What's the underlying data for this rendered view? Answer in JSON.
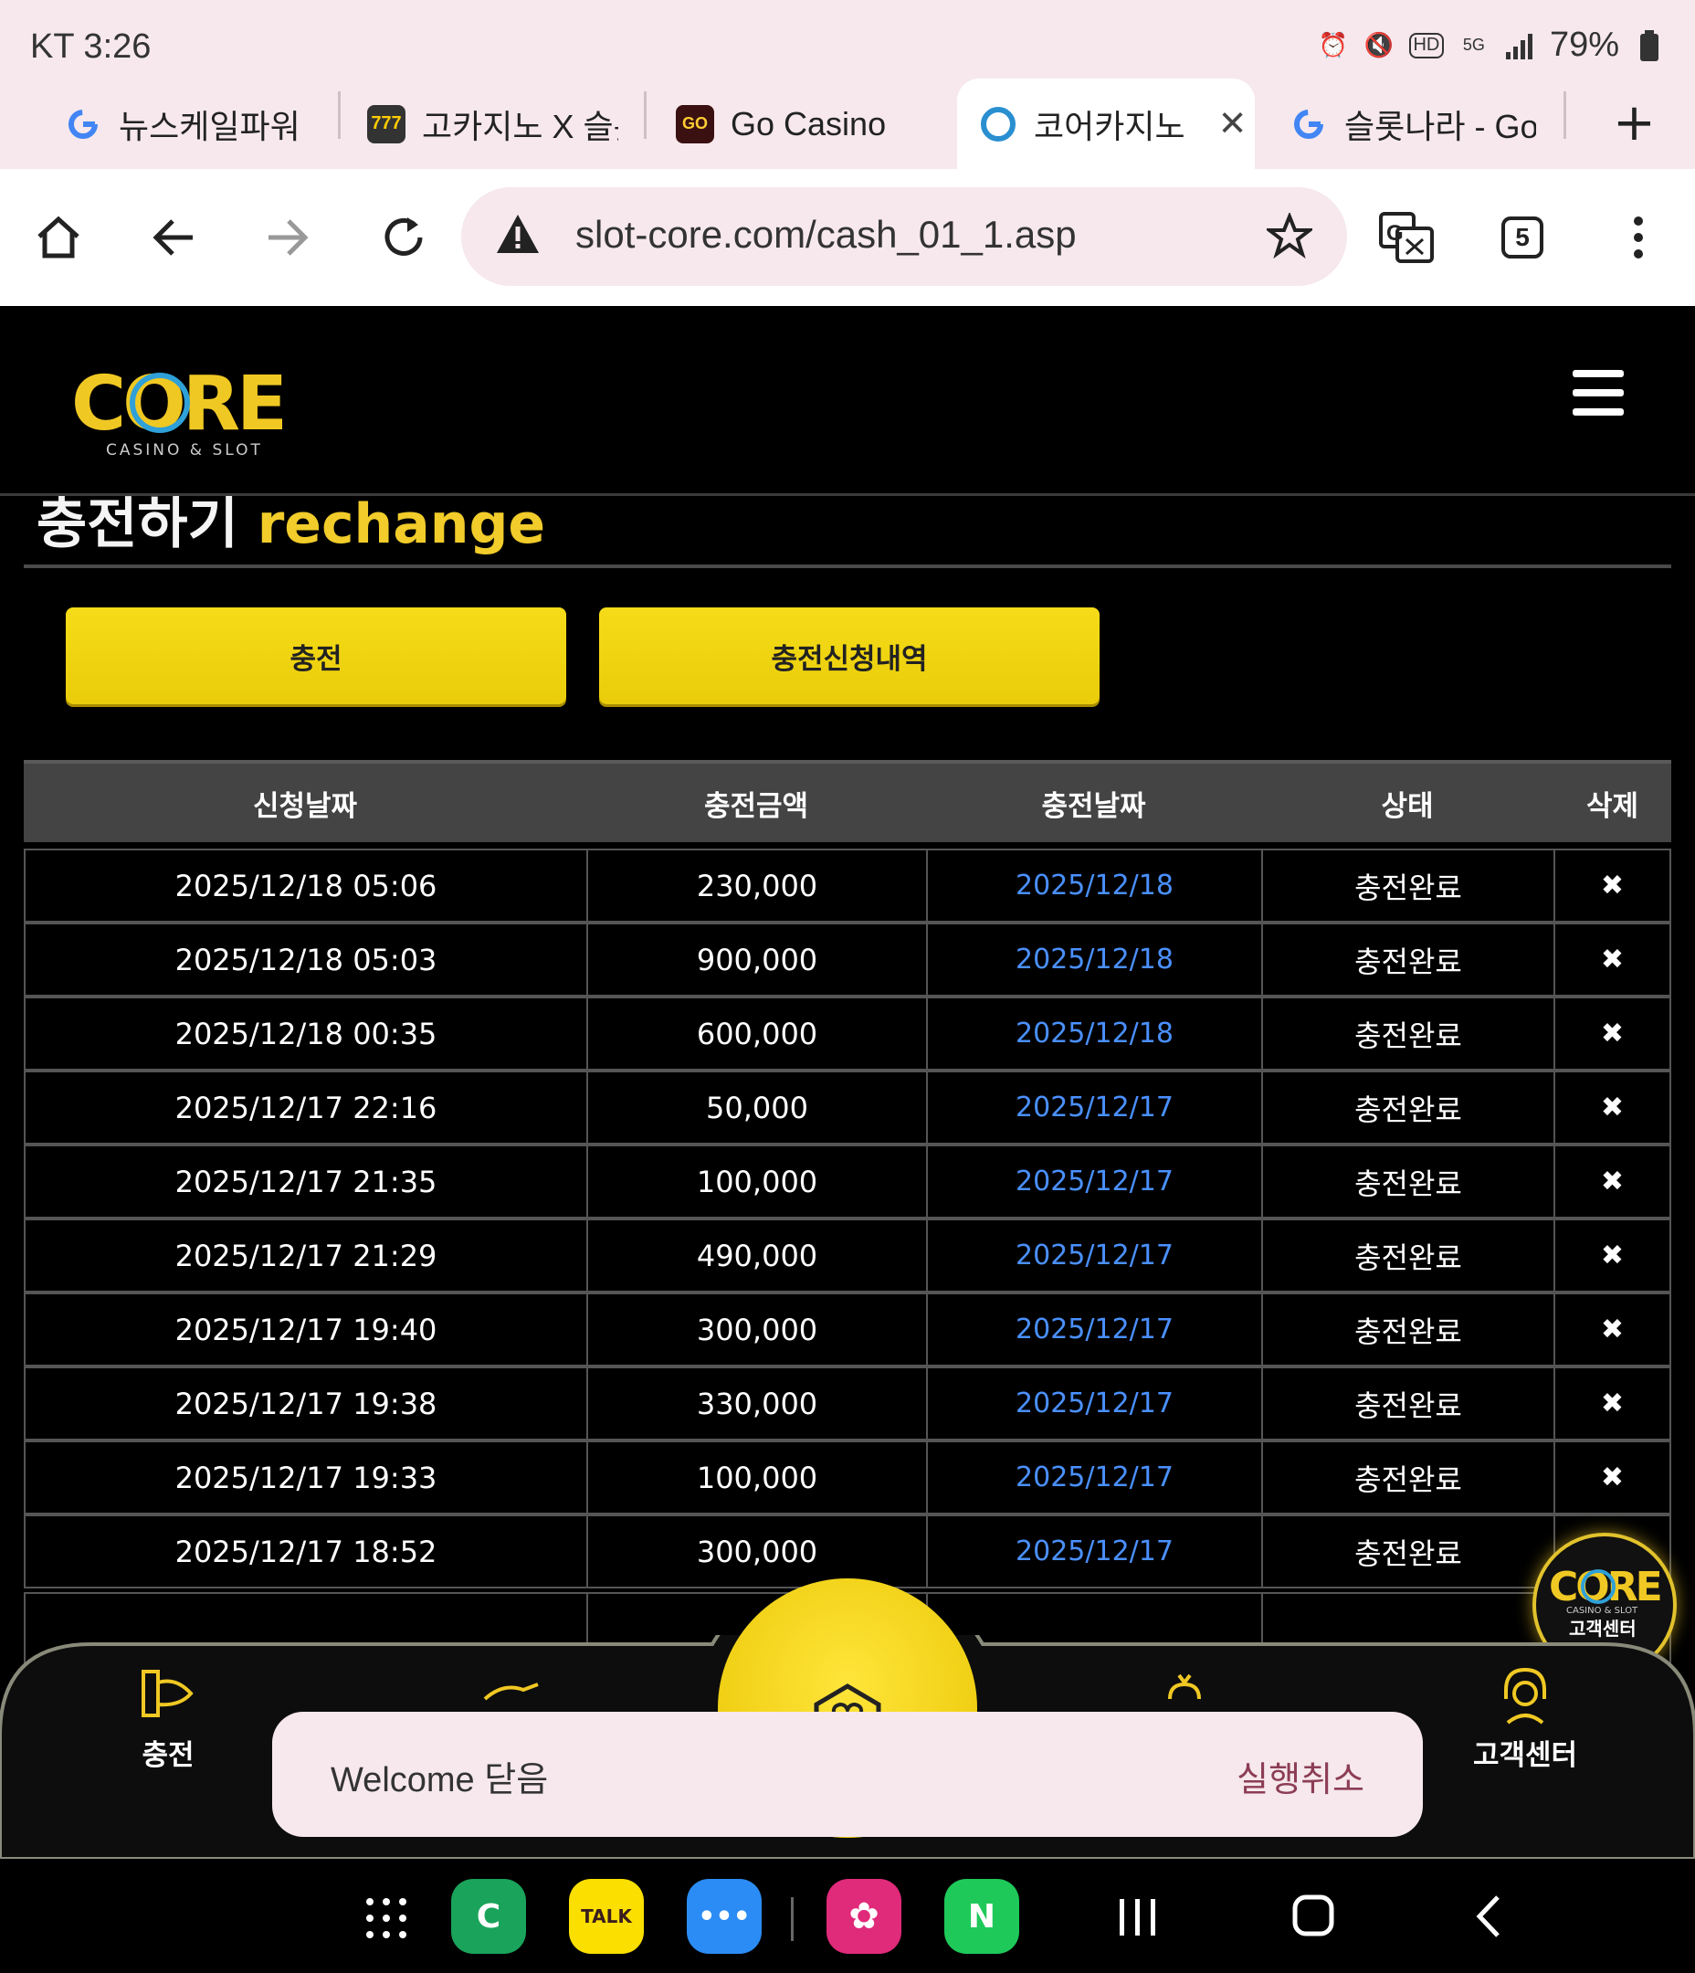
{
  "status_bar": {
    "carrier_time": "KT 3:26",
    "battery": "79%"
  },
  "tabs": [
    {
      "label": "뉴스케일파워 주",
      "favicon": "google-icon"
    },
    {
      "label": "고카지노 X 슬롯",
      "favicon": "slot-icon"
    },
    {
      "label": "Go Casino",
      "favicon": "gocasino-icon"
    },
    {
      "label": "코어카지노",
      "favicon": "core-icon",
      "active": true
    },
    {
      "label": "슬롯나라 - Goo",
      "favicon": "google-icon"
    }
  ],
  "toolbar": {
    "url": "slot-core.com/cash_01_1.asp",
    "tab_count": "5"
  },
  "site": {
    "logo_text": "CORE",
    "logo_sub": "CASINO & SLOT",
    "title_ko": "충전하기",
    "title_en": "rechange",
    "btn_charge": "충전",
    "btn_history": "충전신청내역"
  },
  "table": {
    "headers": [
      "신청날짜",
      "충전금액",
      "충전날짜",
      "상태",
      "삭제"
    ],
    "rows": [
      {
        "req": "2025/12/18 05:06",
        "amount": "230,000",
        "date": "2025/12/18",
        "status": "충전완료",
        "del": "✖"
      },
      {
        "req": "2025/12/18 05:03",
        "amount": "900,000",
        "date": "2025/12/18",
        "status": "충전완료",
        "del": "✖"
      },
      {
        "req": "2025/12/18 00:35",
        "amount": "600,000",
        "date": "2025/12/18",
        "status": "충전완료",
        "del": "✖"
      },
      {
        "req": "2025/12/17 22:16",
        "amount": "50,000",
        "date": "2025/12/17",
        "status": "충전완료",
        "del": "✖"
      },
      {
        "req": "2025/12/17 21:35",
        "amount": "100,000",
        "date": "2025/12/17",
        "status": "충전완료",
        "del": "✖"
      },
      {
        "req": "2025/12/17 21:29",
        "amount": "490,000",
        "date": "2025/12/17",
        "status": "충전완료",
        "del": "✖"
      },
      {
        "req": "2025/12/17 19:40",
        "amount": "300,000",
        "date": "2025/12/17",
        "status": "충전완료",
        "del": "✖"
      },
      {
        "req": "2025/12/17 19:38",
        "amount": "330,000",
        "date": "2025/12/17",
        "status": "충전완료",
        "del": "✖"
      },
      {
        "req": "2025/12/17 19:33",
        "amount": "100,000",
        "date": "2025/12/17",
        "status": "충전완료",
        "del": "✖"
      },
      {
        "req": "2025/12/17 18:52",
        "amount": "300,000",
        "date": "2025/12/17",
        "status": "충전완료",
        "del": ""
      }
    ]
  },
  "bottom_nav": {
    "left_label": "충전",
    "right_label": "고객센터"
  },
  "cs_badge": {
    "logo": "CORE",
    "sub": "CASINO & SLOT",
    "label": "고객센터"
  },
  "snackbar": {
    "message": "Welcome 닫음",
    "action": "실행취소"
  },
  "colors": {
    "accent_yellow": "#f0d418",
    "link_blue": "#4a90ff",
    "chrome_pink": "#f6e8ec"
  }
}
